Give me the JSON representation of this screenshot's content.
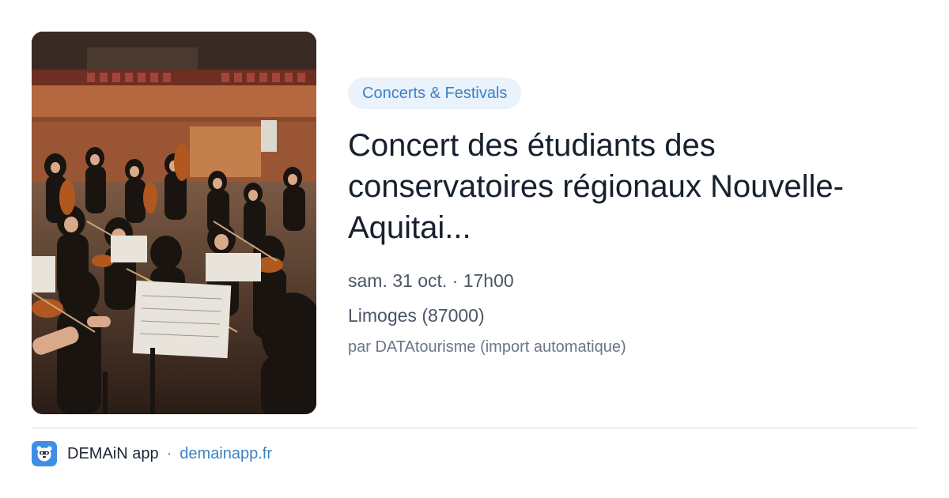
{
  "event": {
    "category": "Concerts & Festivals",
    "title": "Concert des étudiants des conservatoires régionaux Nouvelle-Aquitai...",
    "datetime": "sam. 31 oct. · 17h00",
    "location": "Limoges (87000)",
    "source": "par DATAtourisme (import automatique)",
    "image": "orchestra-photo"
  },
  "footer": {
    "app_name": "DEMAiN app",
    "separator": "·",
    "domain": "demainapp.fr",
    "icon": "demain-app-icon"
  },
  "colors": {
    "chip_bg": "#eaf2fc",
    "accent": "#3b82c4",
    "title": "#16202e",
    "app_icon_bg": "#3d8fe6"
  }
}
